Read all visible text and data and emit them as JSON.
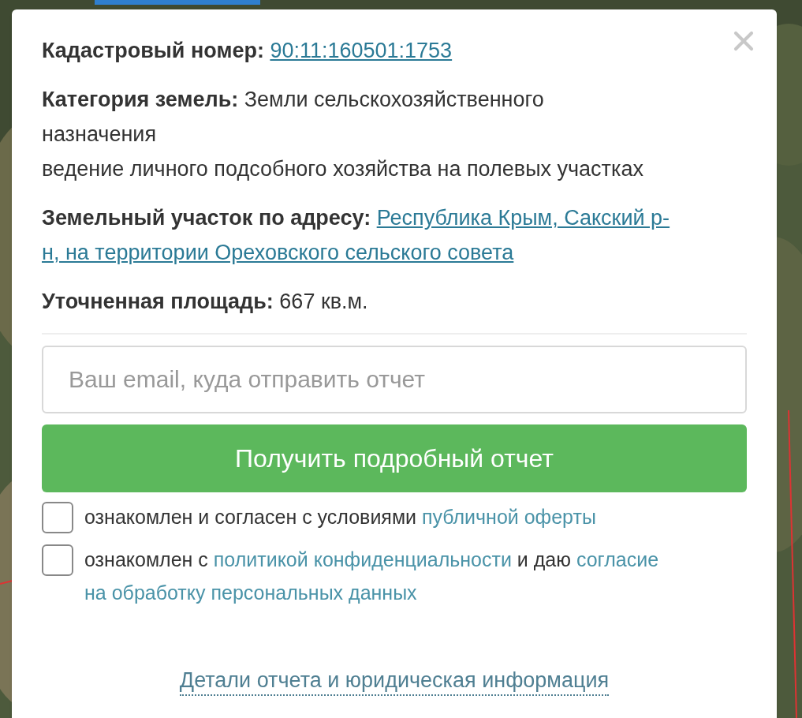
{
  "info": [
    {
      "kind": "link",
      "label": "Кадастровый номер:",
      "lines": [
        "90:11:160501:1753"
      ]
    },
    {
      "kind": "text",
      "label": "Категория земель:",
      "lines": [
        "Земли сельскохозяйственного",
        "назначения",
        "ведение личного подсобного хозяйства на полевых участках"
      ]
    },
    {
      "kind": "link",
      "label": "Земельный участок по адресу:",
      "lines": [
        "Республика Крым, Сакский р-",
        "н, на территории Ореховского сельского совета"
      ]
    },
    {
      "kind": "text",
      "label": "Уточненная площадь:",
      "lines": [
        "667 кв.м."
      ]
    }
  ],
  "email": {
    "placeholder": "Ваш email, куда отправить отчет"
  },
  "submit": "Получить подробный отчет",
  "agreements": [
    {
      "checked": false,
      "lines": [
        [
          {
            "kind": "text",
            "text": "ознакомлен и согласен с условиями "
          },
          {
            "kind": "link",
            "text": "публичной оферты"
          }
        ]
      ]
    },
    {
      "checked": false,
      "lines": [
        [
          {
            "kind": "text",
            "text": "ознакомлен с "
          },
          {
            "kind": "link",
            "text": "политикой конфиденциальности"
          },
          {
            "kind": "text",
            "text": " и даю "
          },
          {
            "kind": "link",
            "text": "согласие"
          }
        ],
        [
          {
            "kind": "link",
            "text": "на обработку персональных данных"
          }
        ]
      ]
    }
  ],
  "footer_link": "Детали отчета и юридическая информация"
}
